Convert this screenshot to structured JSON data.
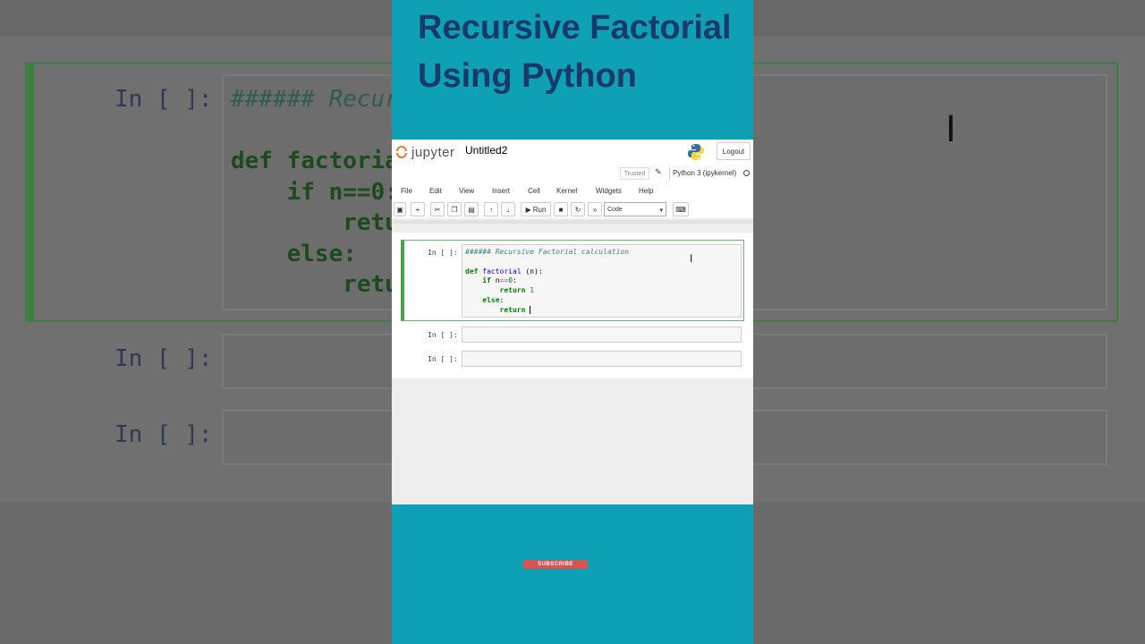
{
  "video": {
    "title": "Recursive Factorial Using Python",
    "subscribe_label": "SUBSCRIBE"
  },
  "notebook": {
    "logo_text": "jupyter",
    "name": "Untitled2",
    "logout_label": "Logout",
    "trusted_label": "Trusted",
    "kernel_name": "Python 3 (ipykernel)",
    "menu": [
      "File",
      "Edit",
      "View",
      "Insert",
      "Cell",
      "Kernel",
      "Widgets",
      "Help"
    ],
    "toolbar": {
      "run_label": "Run",
      "cell_type": "Code"
    },
    "cells": [
      {
        "prompt": "In [ ]:",
        "lines": [
          "###### Recursive Factorial calculation",
          "",
          "def factorial (n):",
          "    if n==0:",
          "        return 1",
          "    else:",
          "        return "
        ]
      },
      {
        "prompt": "In [ ]:",
        "lines": []
      },
      {
        "prompt": "In [ ]:",
        "lines": []
      }
    ]
  },
  "background": {
    "prompt": "In [ ]:",
    "code": [
      "###### Recur",
      "",
      "def factoria",
      "    if n==0:",
      "        retu",
      "    else:",
      "        retu"
    ]
  }
}
